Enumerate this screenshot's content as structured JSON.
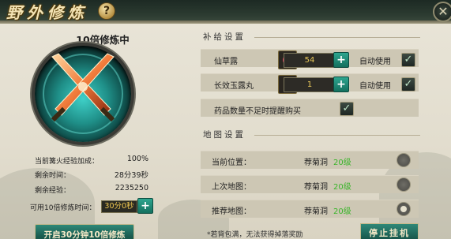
{
  "window": {
    "title": "野外修炼"
  },
  "left": {
    "status_title": "10倍修炼中",
    "stats": [
      {
        "label": "当前篝火经验加成：",
        "value": "100%"
      },
      {
        "label": "剩余时间：",
        "value": "28分39秒"
      },
      {
        "label": "剩余经验：",
        "value": "2235250"
      }
    ],
    "time_label": "可用10倍修炼时间：",
    "time_value": "30分0秒",
    "start_button": "开启30分钟10倍修炼"
  },
  "supply": {
    "heading": "补给设置",
    "items": [
      {
        "name": "仙草露",
        "qty": "54",
        "auto_label": "自动使用",
        "checked": true
      },
      {
        "name": "长效玉露丸",
        "qty": "1",
        "auto_label": "自动使用",
        "checked": true
      }
    ],
    "remind_label": "药品数量不足时提醒购买",
    "remind_checked": true
  },
  "map": {
    "heading": "地图设置",
    "rows": [
      {
        "label": "当前位置：",
        "place": "荐菊洞",
        "level": "20级",
        "selected": false
      },
      {
        "label": "上次地图：",
        "place": "荐菊洞",
        "level": "20级",
        "selected": false
      },
      {
        "label": "推荐地图：",
        "place": "荐菊洞",
        "level": "20级",
        "selected": true
      }
    ]
  },
  "footer": {
    "note": "*若背包满，无法获得掉落奖励",
    "stop_button": "停止挂机"
  },
  "colors": {
    "accent": "#1b5d51",
    "level": "#3ab42a",
    "value": "#f0c850"
  }
}
